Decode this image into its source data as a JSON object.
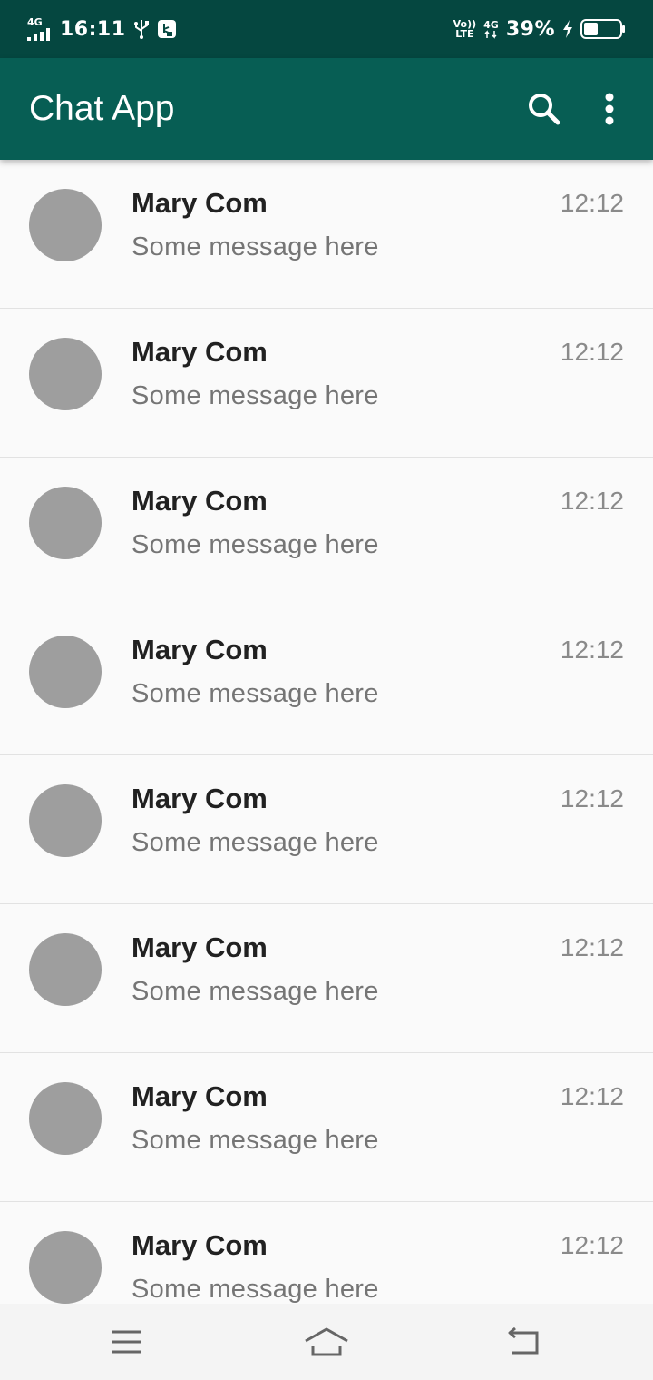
{
  "status_bar": {
    "network_left": "4G",
    "time": "16:11",
    "volte_top": "Vo))",
    "volte_bottom": "LTE",
    "network_right": "4G",
    "battery_percent": "39%",
    "battery_level": 0.39,
    "background_color": "#054740",
    "icons": [
      "signal-icon",
      "usb-icon",
      "usb-debug-icon",
      "data-arrows-icon",
      "charging-icon",
      "battery-icon"
    ]
  },
  "app_bar": {
    "title": "Chat App",
    "background_color": "#075e54",
    "actions": [
      {
        "icon": "search-icon"
      },
      {
        "icon": "more-vert-icon"
      }
    ]
  },
  "chats": [
    {
      "name": "Mary Com",
      "message": "Some message here",
      "time": "12:12"
    },
    {
      "name": "Mary Com",
      "message": "Some message here",
      "time": "12:12"
    },
    {
      "name": "Mary Com",
      "message": "Some message here",
      "time": "12:12"
    },
    {
      "name": "Mary Com",
      "message": "Some message here",
      "time": "12:12"
    },
    {
      "name": "Mary Com",
      "message": "Some message here",
      "time": "12:12"
    },
    {
      "name": "Mary Com",
      "message": "Some message here",
      "time": "12:12"
    },
    {
      "name": "Mary Com",
      "message": "Some message here",
      "time": "12:12"
    },
    {
      "name": "Mary Com",
      "message": "Some message here",
      "time": "12:12"
    }
  ],
  "avatar_color": "#9e9e9e",
  "nav_bar": {
    "buttons": [
      {
        "icon": "menu-icon"
      },
      {
        "icon": "home-icon"
      },
      {
        "icon": "back-icon"
      }
    ]
  }
}
